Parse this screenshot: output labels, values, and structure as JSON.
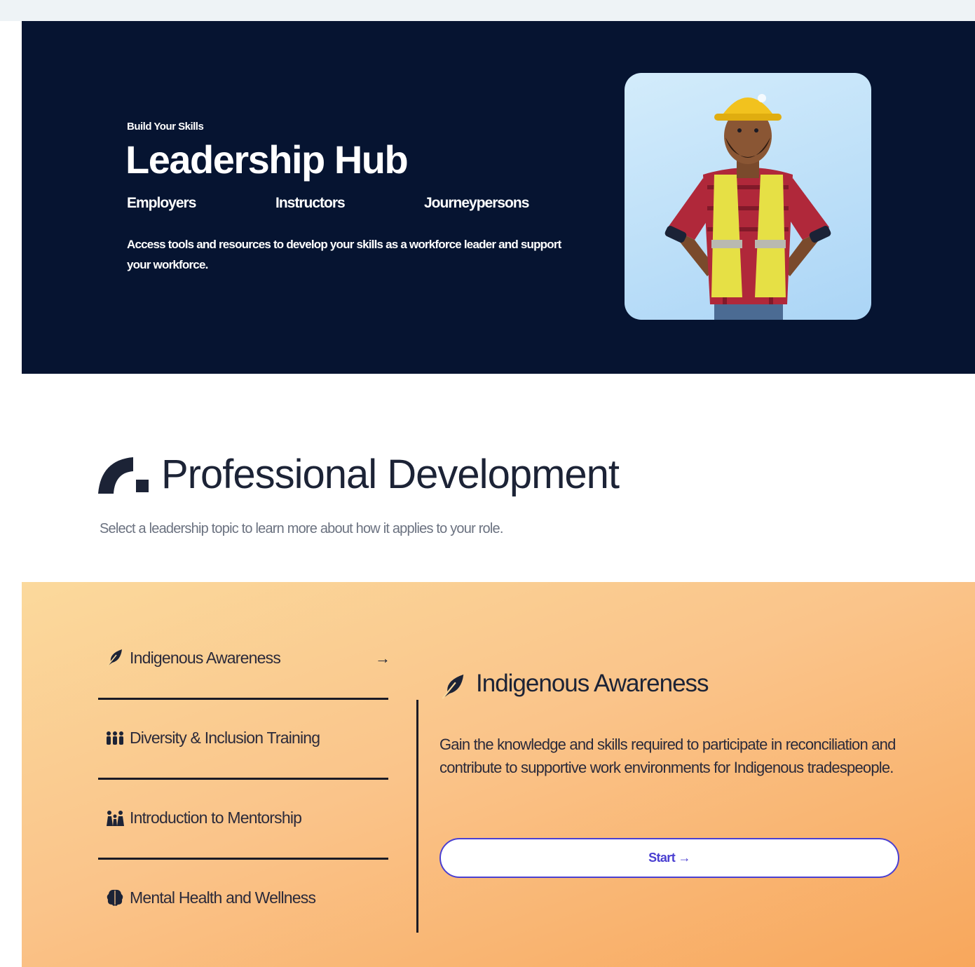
{
  "hero": {
    "eyebrow": "Build Your Skills",
    "title": "Leadership Hub",
    "audiences": [
      "Employers",
      "Instructors",
      "Journeypersons"
    ],
    "description": "Access tools and resources to develop your skills as a workforce leader and support your workforce."
  },
  "professional_development": {
    "title": "Professional Development",
    "subtitle": "Select a leadership topic to learn more about how it applies to your role."
  },
  "topics": [
    {
      "label": "Indigenous Awareness",
      "icon": "feather-icon",
      "active": true
    },
    {
      "label": "Diversity & Inclusion Training",
      "icon": "people-group-icon",
      "active": false
    },
    {
      "label": "Introduction to Mentorship",
      "icon": "mentorship-icon",
      "active": false
    },
    {
      "label": "Mental Health and Wellness",
      "icon": "brain-icon",
      "active": false
    }
  ],
  "detail": {
    "title": "Indigenous Awareness",
    "icon": "feather-icon",
    "description": "Gain the knowledge and skills required to participate in reconciliation and contribute to supportive work environments for Indigenous tradespeople.",
    "button_label": "Start →"
  },
  "colors": {
    "hero_bg": "#061431",
    "accent": "#4a3fd1",
    "panel_gradient_start": "#fbd99c",
    "panel_gradient_end": "#f8a75c",
    "text_dark": "#1c2336"
  }
}
